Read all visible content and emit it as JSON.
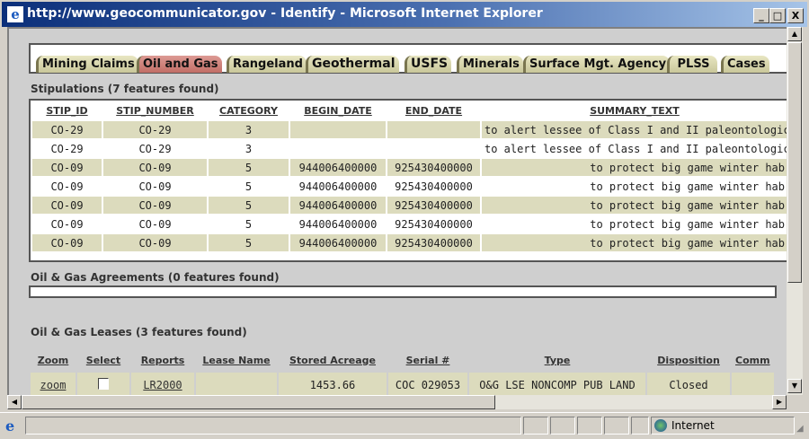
{
  "window": {
    "title": "http://www.geocommunicator.gov - Identify - Microsoft Internet Explorer",
    "minimize": "_",
    "maximize": "□",
    "close": "X"
  },
  "tabs": [
    {
      "label": "Mining Claims"
    },
    {
      "label": "Oil and Gas",
      "active": true
    },
    {
      "label": "Rangeland"
    },
    {
      "label": "Geothermal"
    },
    {
      "label": "USFS"
    },
    {
      "label": "Minerals"
    },
    {
      "label": "Surface Mgt. Agency"
    },
    {
      "label": "PLSS"
    },
    {
      "label": "Cases"
    }
  ],
  "stipulations": {
    "label": "Stipulations (7 features found)",
    "headers": [
      "STIP_ID",
      "STIP_NUMBER",
      "CATEGORY",
      "BEGIN_DATE",
      "END_DATE",
      "SUMMARY_TEXT"
    ],
    "rows": [
      [
        "CO-29",
        "CO-29",
        "3",
        "",
        "",
        "to alert lessee of Class I and II paleontological are"
      ],
      [
        "CO-29",
        "CO-29",
        "3",
        "",
        "",
        "to alert lessee of Class I and II paleontological are"
      ],
      [
        "CO-09",
        "CO-09",
        "5",
        "944006400000",
        "925430400000",
        "to protect big game winter hab"
      ],
      [
        "CO-09",
        "CO-09",
        "5",
        "944006400000",
        "925430400000",
        "to protect big game winter hab"
      ],
      [
        "CO-09",
        "CO-09",
        "5",
        "944006400000",
        "925430400000",
        "to protect big game winter hab"
      ],
      [
        "CO-09",
        "CO-09",
        "5",
        "944006400000",
        "925430400000",
        "to protect big game winter hab"
      ],
      [
        "CO-09",
        "CO-09",
        "5",
        "944006400000",
        "925430400000",
        "to protect big game winter hab"
      ]
    ]
  },
  "agreements": {
    "label": "Oil & Gas Agreements (0 features found)"
  },
  "leases": {
    "label": "Oil & Gas Leases (3 features found)",
    "headers": [
      "Zoom",
      "Select",
      "Reports",
      "Lease Name",
      "Stored Acreage",
      "Serial #",
      "Type",
      "Disposition",
      "Comm"
    ],
    "row": {
      "zoom": "zoom",
      "select": false,
      "reports": "LR2000",
      "lease_name": "",
      "acreage": "1453.66",
      "serial": "COC 029053",
      "type": "O&G LSE NONCOMP PUB LAND",
      "disposition": "Closed",
      "comm": ""
    }
  },
  "status": {
    "zone": "Internet"
  }
}
